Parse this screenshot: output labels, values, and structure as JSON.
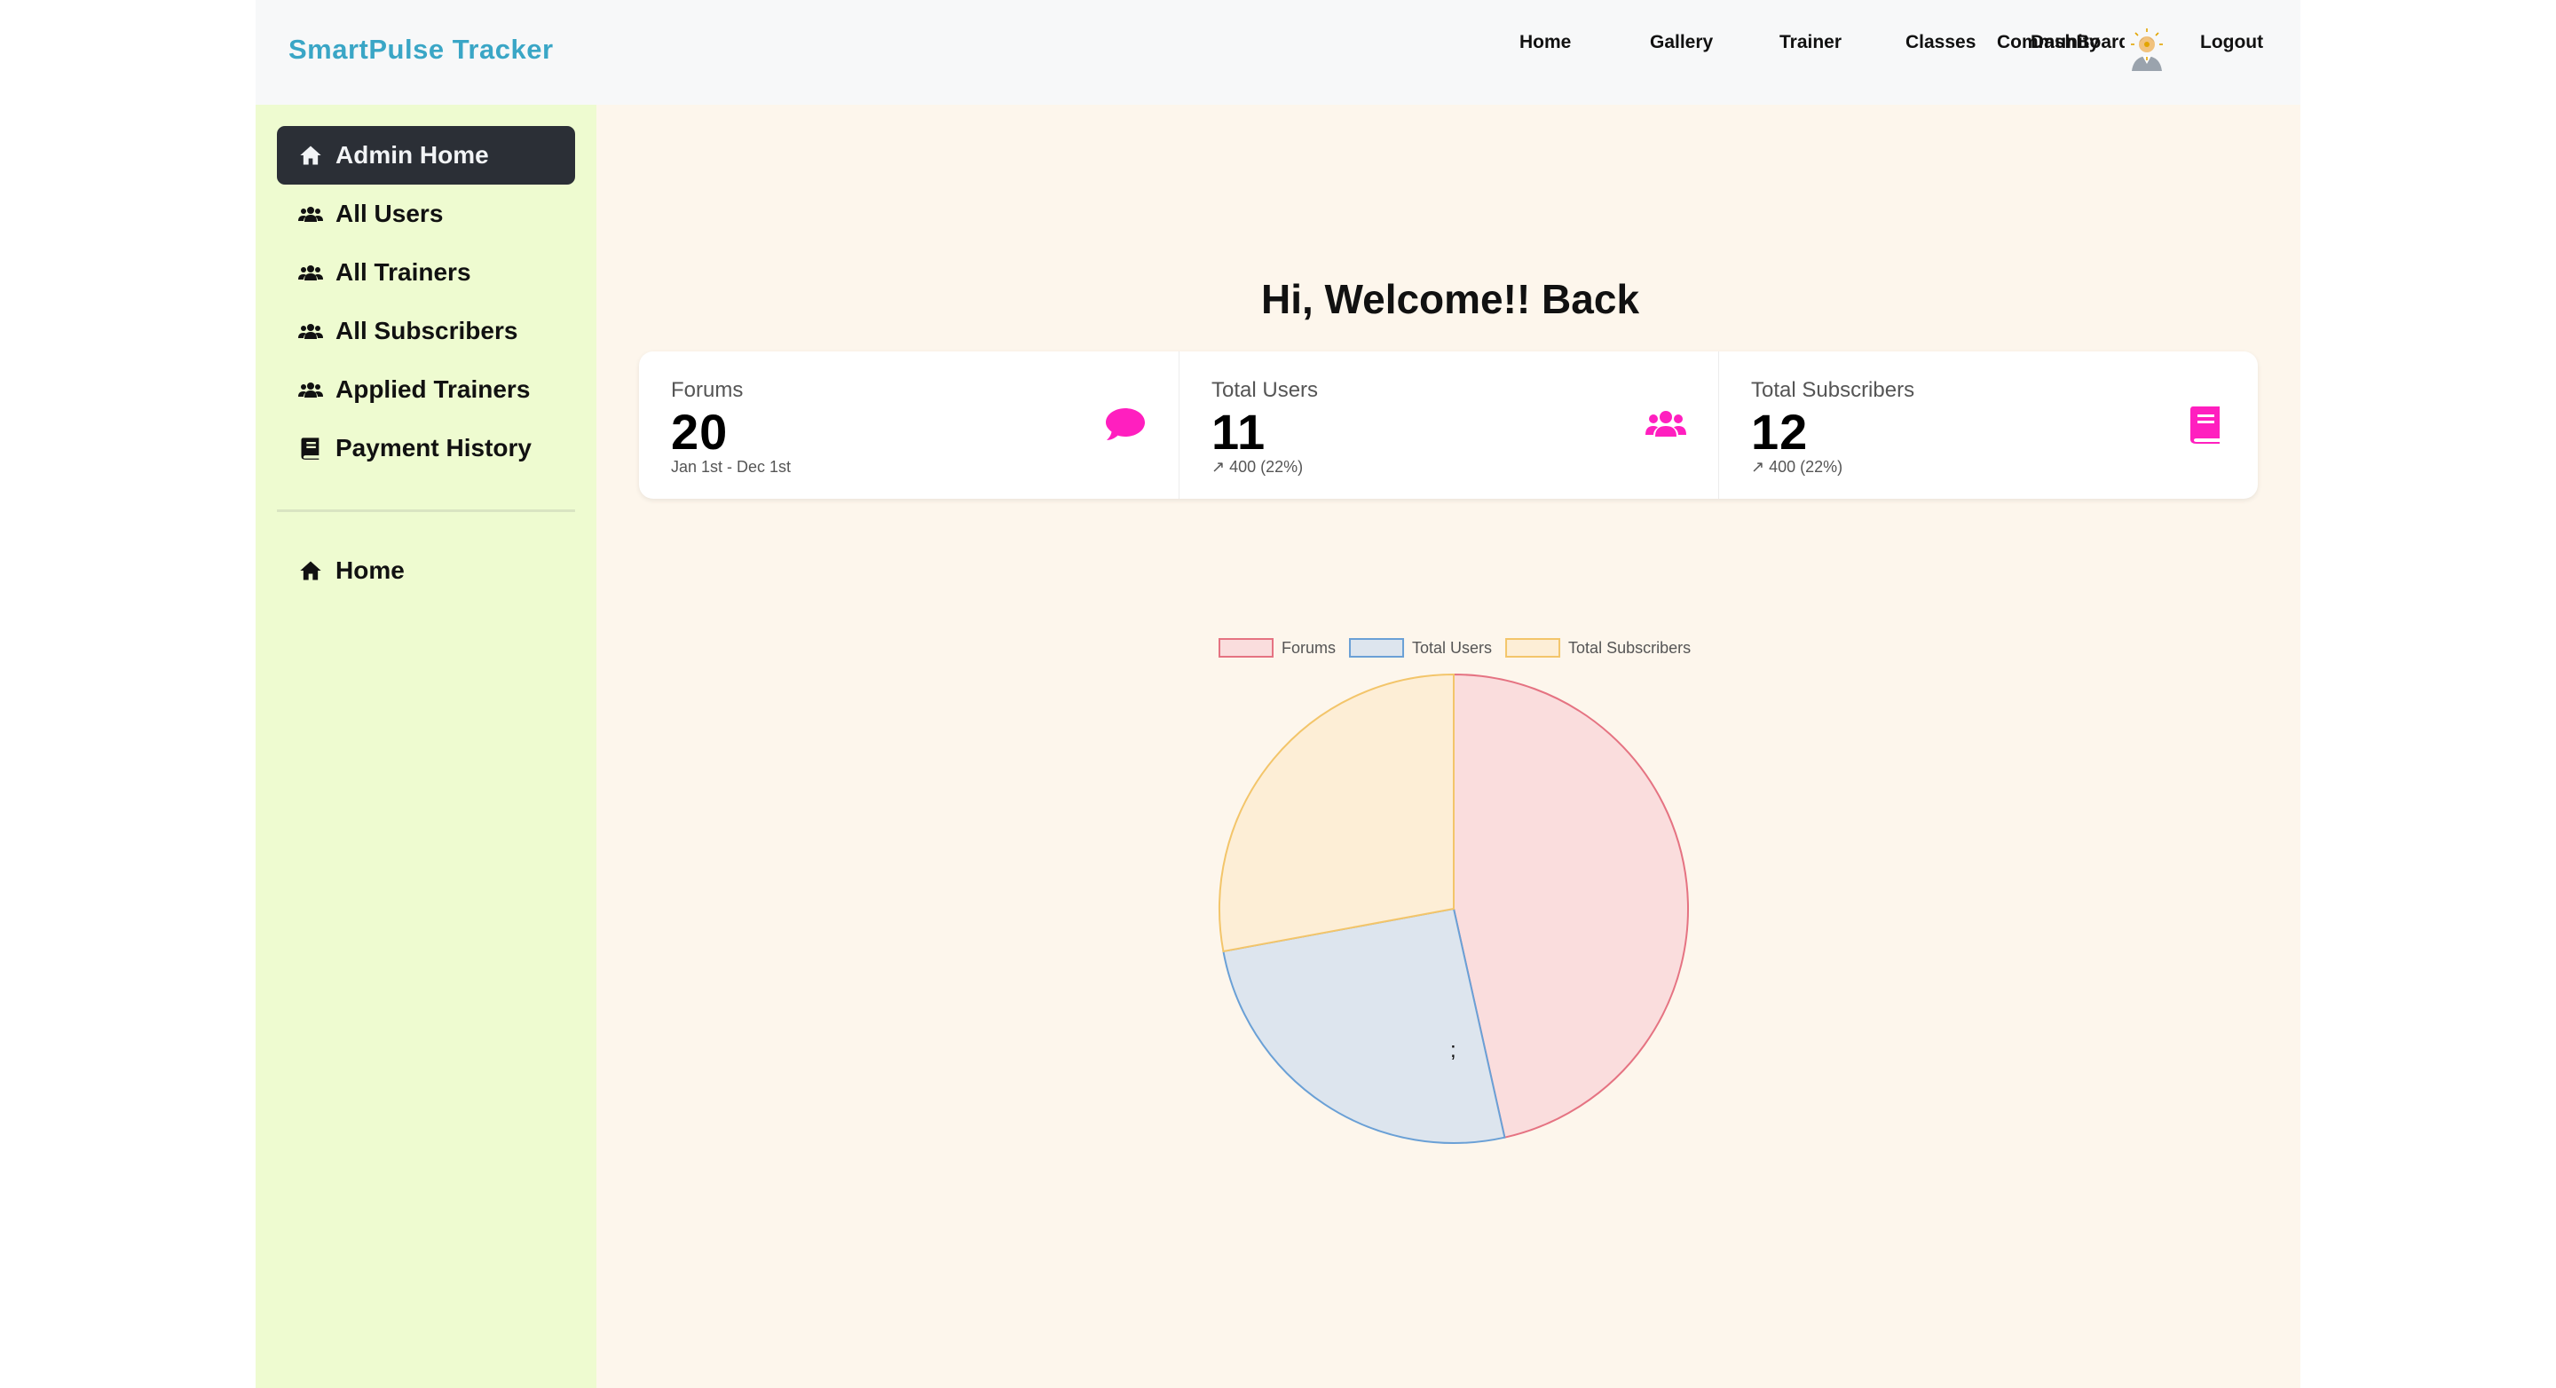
{
  "navbar": {
    "brand": "SmartPulse Tracker",
    "links": [
      "Home",
      "Gallery",
      "Trainer",
      "Classes",
      "DashBoard",
      "Community"
    ],
    "logout": "Logout",
    "avatar_icon": "user-avatar"
  },
  "sidebar": {
    "items": [
      {
        "label": "Admin Home",
        "icon": "home-icon",
        "active": true
      },
      {
        "label": "All Users",
        "icon": "users-icon"
      },
      {
        "label": "All Trainers",
        "icon": "users-icon"
      },
      {
        "label": "All Subscribers",
        "icon": "users-icon"
      },
      {
        "label": "Applied Trainers",
        "icon": "users-icon"
      },
      {
        "label": "Payment History",
        "icon": "book-icon"
      }
    ],
    "bottom_items": [
      {
        "label": "Home",
        "icon": "home-icon"
      }
    ]
  },
  "main": {
    "welcome": "Hi, Welcome!! Back",
    "stats": [
      {
        "title": "Forums",
        "value": "20",
        "desc": "Jan 1st - Dec 1st",
        "icon": "chat-icon"
      },
      {
        "title": "Total Users",
        "value": "11",
        "desc": "↗︎ 400 (22%)",
        "icon": "users-icon"
      },
      {
        "title": "Total Subscribers",
        "value": "12",
        "desc": "↗︎ 400 (22%)",
        "icon": "book-icon"
      }
    ],
    "stray_text": ";"
  },
  "colors": {
    "accent_pink": "#ff1fbf",
    "brand": "#3aa6c6",
    "sidebar_bg": "#eefbd0",
    "main_bg": "#fdf6ec"
  },
  "chart_data": {
    "type": "pie",
    "labels": [
      "Forums",
      "Total Users",
      "Total Subscribers"
    ],
    "values": [
      20,
      11,
      12
    ],
    "colors": {
      "fill": [
        "#fadddd",
        "#dde5ee",
        "#fdeed6"
      ],
      "border": [
        "#e57382",
        "#6aa0d6",
        "#f3c56a"
      ]
    },
    "legend": "top"
  }
}
